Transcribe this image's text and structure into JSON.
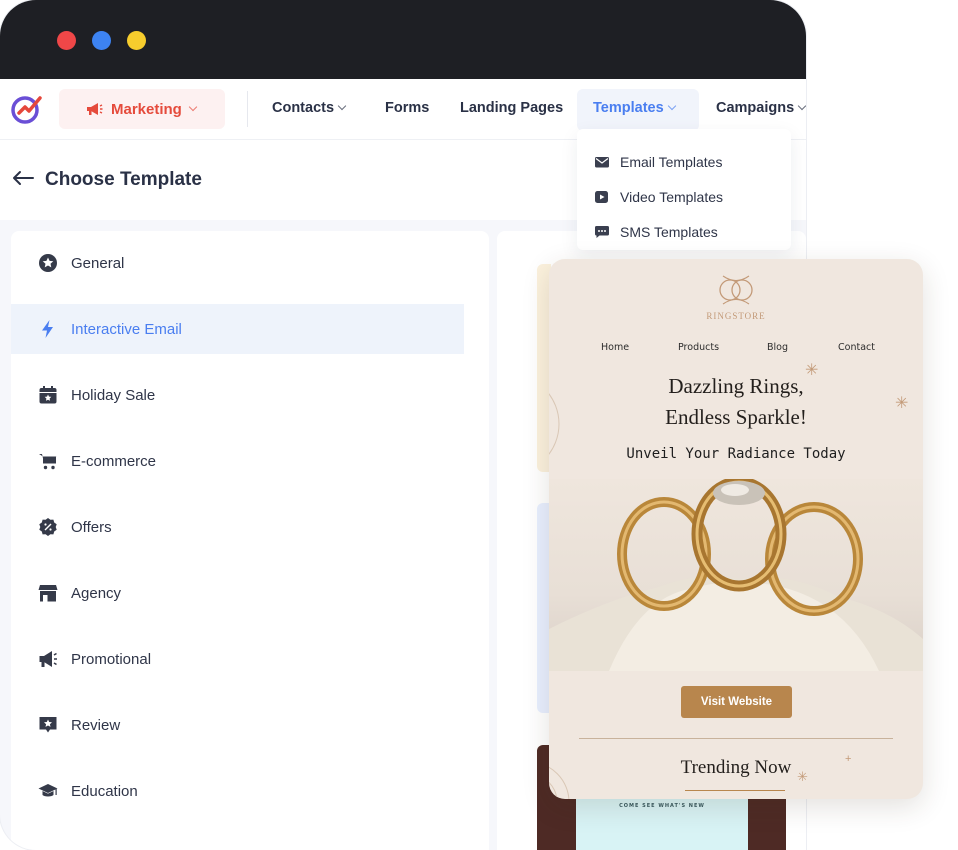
{
  "nav": {
    "marketing_label": "Marketing",
    "items": [
      {
        "label": "Contacts"
      },
      {
        "label": "Forms"
      },
      {
        "label": "Landing Pages"
      },
      {
        "label": "Templates"
      },
      {
        "label": "Campaigns"
      }
    ]
  },
  "dropdown": {
    "items": [
      {
        "label": "Email Templates",
        "icon": "envelope-icon"
      },
      {
        "label": "Video Templates",
        "icon": "video-icon"
      },
      {
        "label": "SMS Templates",
        "icon": "chat-icon"
      }
    ]
  },
  "page": {
    "title": "Choose Template"
  },
  "categories": [
    {
      "label": "General",
      "icon": "star-badge-icon"
    },
    {
      "label": "Interactive Email",
      "icon": "lightning-icon"
    },
    {
      "label": "Holiday Sale",
      "icon": "calendar-star-icon"
    },
    {
      "label": "E-commerce",
      "icon": "cart-icon"
    },
    {
      "label": "Offers",
      "icon": "percent-badge-icon"
    },
    {
      "label": "Agency",
      "icon": "storefront-icon"
    },
    {
      "label": "Promotional",
      "icon": "megaphone-icon"
    },
    {
      "label": "Review",
      "icon": "star-message-icon"
    },
    {
      "label": "Education",
      "icon": "graduation-cap-icon"
    }
  ],
  "preview": {
    "brand": "RINGSTORE",
    "nav": [
      "Home",
      "Products",
      "Blog",
      "Contact"
    ],
    "headline_1": "Dazzling Rings,",
    "headline_2": "Endless Sparkle!",
    "subheadline": "Unveil Your Radiance Today",
    "button": "Visit Website",
    "section_title": "Trending Now",
    "next_template_heading": "COME SEE WHAT'S NEW"
  },
  "colors": {
    "accent_blue": "#4a7ef0",
    "marketing_red": "#e54b3c",
    "titlebar": "#1e1f24",
    "button_gold": "#b8864d"
  }
}
